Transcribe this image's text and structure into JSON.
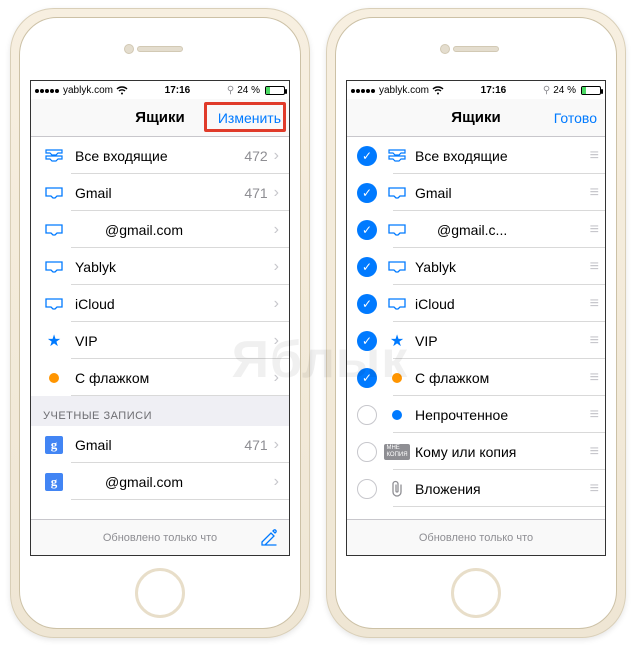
{
  "statusbar": {
    "carrier": "yablyk.com",
    "time": "17:16",
    "battery_pct": "24 %"
  },
  "watermark": "Яблык",
  "left_phone": {
    "header": {
      "title": "Ящики",
      "action": "Изменить"
    },
    "mailboxes": [
      {
        "icon": "inbox-all",
        "label": "Все входящие",
        "badge": "472"
      },
      {
        "icon": "inbox",
        "label": "Gmail",
        "badge": "471"
      },
      {
        "icon": "inbox",
        "label": "@gmail.com",
        "indent": true
      },
      {
        "icon": "inbox",
        "label": "Yablyk"
      },
      {
        "icon": "inbox",
        "label": "iCloud"
      },
      {
        "icon": "star",
        "label": "VIP"
      },
      {
        "icon": "flag-dot",
        "label": "С флажком"
      }
    ],
    "section_header": "УЧЕТНЫЕ ЗАПИСИ",
    "accounts": [
      {
        "icon": "google",
        "label": "Gmail",
        "badge": "471"
      },
      {
        "icon": "google",
        "label": "@gmail.com",
        "indent": true
      }
    ],
    "footer": "Обновлено только что"
  },
  "right_phone": {
    "header": {
      "title": "Ящики",
      "action": "Готово"
    },
    "mailboxes": [
      {
        "checked": true,
        "icon": "inbox-all",
        "label": "Все входящие"
      },
      {
        "checked": true,
        "icon": "inbox",
        "label": "Gmail"
      },
      {
        "checked": true,
        "icon": "inbox",
        "label": "@gmail.c...",
        "indent": true
      },
      {
        "checked": true,
        "icon": "inbox",
        "label": "Yablyk"
      },
      {
        "checked": true,
        "icon": "inbox",
        "label": "iCloud"
      },
      {
        "checked": true,
        "icon": "star",
        "label": "VIP"
      },
      {
        "checked": true,
        "icon": "flag-dot",
        "label": "С флажком"
      },
      {
        "checked": false,
        "icon": "blue-dot",
        "label": "Непрочтенное"
      },
      {
        "checked": false,
        "icon": "cc",
        "label": "Кому или копия"
      },
      {
        "checked": false,
        "icon": "clip",
        "label": "Вложения"
      }
    ],
    "footer": "Обновлено только что"
  }
}
